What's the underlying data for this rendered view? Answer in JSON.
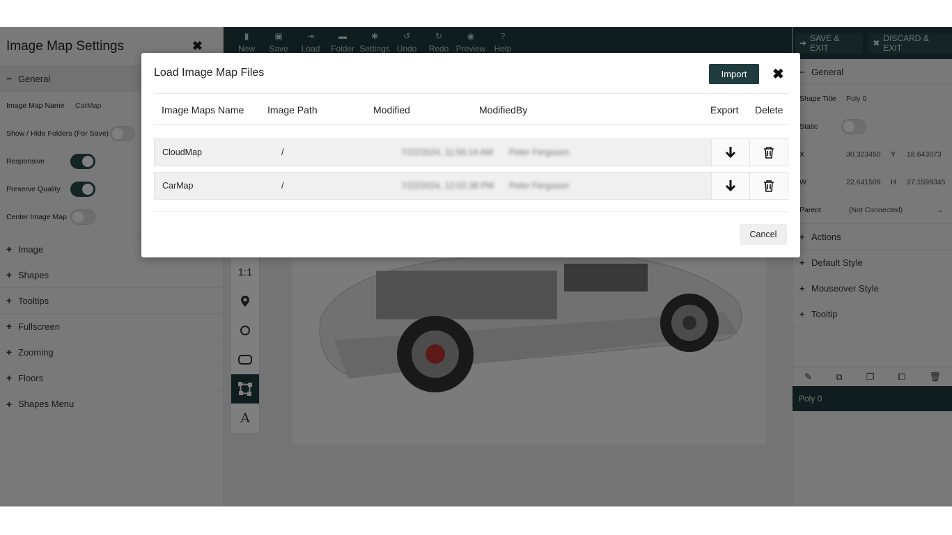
{
  "left_panel": {
    "title": "Image Map Settings",
    "close_glyph": "✖",
    "general_label": "General",
    "rows": {
      "name_label": "Image Map Name",
      "name_value": "CarMap",
      "folders_label": "Show / Hide Folders (For Save)",
      "responsive_label": "Responsive",
      "quality_label": "Preserve Quality",
      "center_label": "Center Image Map"
    },
    "sections": [
      "Image",
      "Shapes",
      "Tooltips",
      "Fullscreen",
      "Zooming",
      "Floors",
      "Shapes Menu"
    ]
  },
  "toolbar": {
    "items": [
      "New",
      "Save",
      "Load",
      "Folder",
      "Settings",
      "Undo",
      "Redo",
      "Preview",
      "Help"
    ]
  },
  "tools": {
    "zoom_label": "1:1",
    "text_glyph": "A"
  },
  "right_panel": {
    "save_exit": "SAVE & EXIT",
    "discard_exit": "DISCARD & EXIT",
    "general_label": "General",
    "shape_title_label": "Shape Title",
    "shape_title_value": "Poly 0",
    "static_label": "Static",
    "x_label": "X",
    "x_value": "30.323450",
    "y_label": "Y",
    "y_value": "18.643073",
    "w_label": "W",
    "w_value": "22.641509",
    "h_label": "H",
    "h_value": "27.1599345",
    "parent_label": "Parent",
    "parent_value": "(Not Connected)",
    "sections": [
      "Actions",
      "Default Style",
      "Mouseover Style",
      "Tooltip"
    ],
    "shape_item": "Poly 0"
  },
  "modal": {
    "title": "Load Image Map Files",
    "import_label": "Import",
    "close_glyph": "✖",
    "columns": [
      "Image Maps Name",
      "Image Path",
      "Modified",
      "ModifiedBy",
      "Export",
      "Delete"
    ],
    "rows": [
      {
        "name": "CloudMap",
        "path": "/",
        "modified": "7/22/2024, 11:56:14 AM",
        "modified_by": "Peter Ferguson"
      },
      {
        "name": "CarMap",
        "path": "/",
        "modified": "7/22/2024, 12:02:38 PM",
        "modified_by": "Peter Ferguson"
      }
    ],
    "cancel_label": "Cancel"
  }
}
